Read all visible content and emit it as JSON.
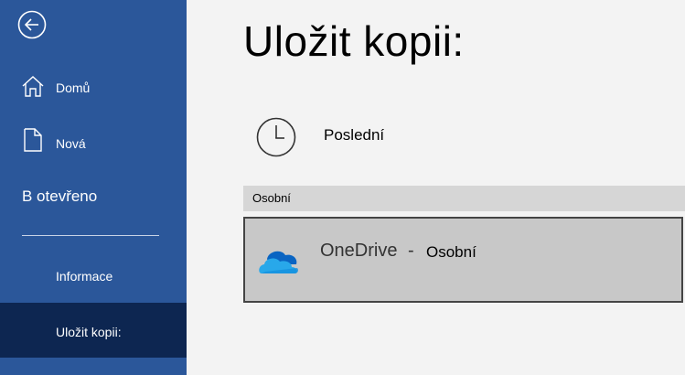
{
  "sidebar": {
    "back_icon": "back-arrow-icon",
    "items": [
      {
        "label": "Domů",
        "icon": "home-icon"
      },
      {
        "label": "Nová",
        "icon": "new-document-icon"
      }
    ],
    "section_label": "B otevřeno",
    "subitems": [
      {
        "label": "Informace"
      },
      {
        "label": "Uložit kopii:",
        "selected": true
      }
    ],
    "bg_color": "#2b579a",
    "selected_color": "#0d2651"
  },
  "main": {
    "title": "Uložit kopii:",
    "recent": {
      "label": "Poslední",
      "icon": "clock-icon"
    },
    "group_header": "Osobní",
    "locations": [
      {
        "name": "OneDrive",
        "separator": "-",
        "account": "Osobní",
        "icon": "onedrive-cloud-icon"
      }
    ]
  }
}
